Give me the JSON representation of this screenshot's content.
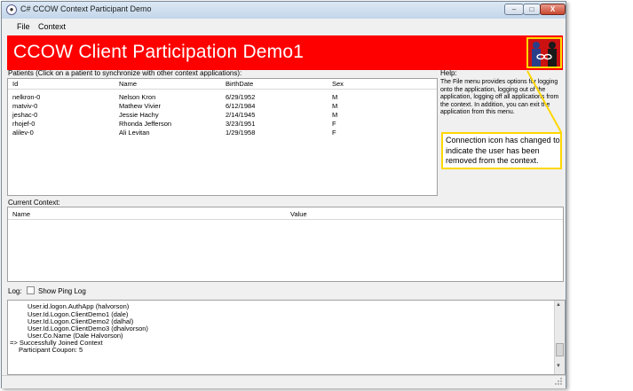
{
  "window": {
    "title": "C# CCOW Context Participant Demo",
    "min_glyph": "–",
    "max_glyph": "□",
    "close_glyph": "X"
  },
  "menu": {
    "items": [
      {
        "label": "File"
      },
      {
        "label": "Context"
      }
    ]
  },
  "banner": {
    "title": "CCOW Client Participation Demo1",
    "background": "#ff0000"
  },
  "patients": {
    "caption": "Patients (Click on a patient to synchronize with other context applications):",
    "columns": [
      "Id",
      "Name",
      "BirthDate",
      "Sex"
    ],
    "rows": [
      {
        "id": "nelkron-0",
        "name": "Nelson Kron",
        "birthdate": "6/29/1952",
        "sex": "M"
      },
      {
        "id": "matviv-0",
        "name": "Mathew Vivier",
        "birthdate": "6/12/1984",
        "sex": "M"
      },
      {
        "id": "jeshac-0",
        "name": "Jessie Hachy",
        "birthdate": "2/14/1945",
        "sex": "M"
      },
      {
        "id": "rhojef-0",
        "name": "Rhonda Jefferson",
        "birthdate": "3/23/1951",
        "sex": "F"
      },
      {
        "id": "alilev-0",
        "name": "Ali Levitan",
        "birthdate": "1/29/1958",
        "sex": "F"
      }
    ]
  },
  "help": {
    "caption": "Help:",
    "text": "The File menu provides options for logging onto the application, logging out of the application, logging off all applications from the context. In addition, you can exit the application from this menu."
  },
  "callout": {
    "text": "Connection icon has changed to indicate the user has been removed from the context.",
    "border_color": "#ffd700"
  },
  "context": {
    "caption": "Current Context:",
    "columns": [
      "Name",
      "Value"
    ]
  },
  "log": {
    "caption": "Log:",
    "show_ping_label": "Show Ping Log",
    "lines": [
      "User.id.logon.AuthApp (halvorson)",
      "User.Id.Logon.ClientDemo1 (dale)",
      "User.Id.Logon.ClientDemo2 (dalhal)",
      "User.Id.Logon.ClientDemo3 (dhalvorson)",
      "User.Co.Name (Dale Halvorson)",
      "=> Successfully Joined Context",
      "Participant Coupon: 5"
    ],
    "up_arrow": "▲",
    "down_arrow": "▼"
  },
  "icons": {
    "app": "ccow-app-icon",
    "connection": "broken-chain-connection-icon"
  }
}
